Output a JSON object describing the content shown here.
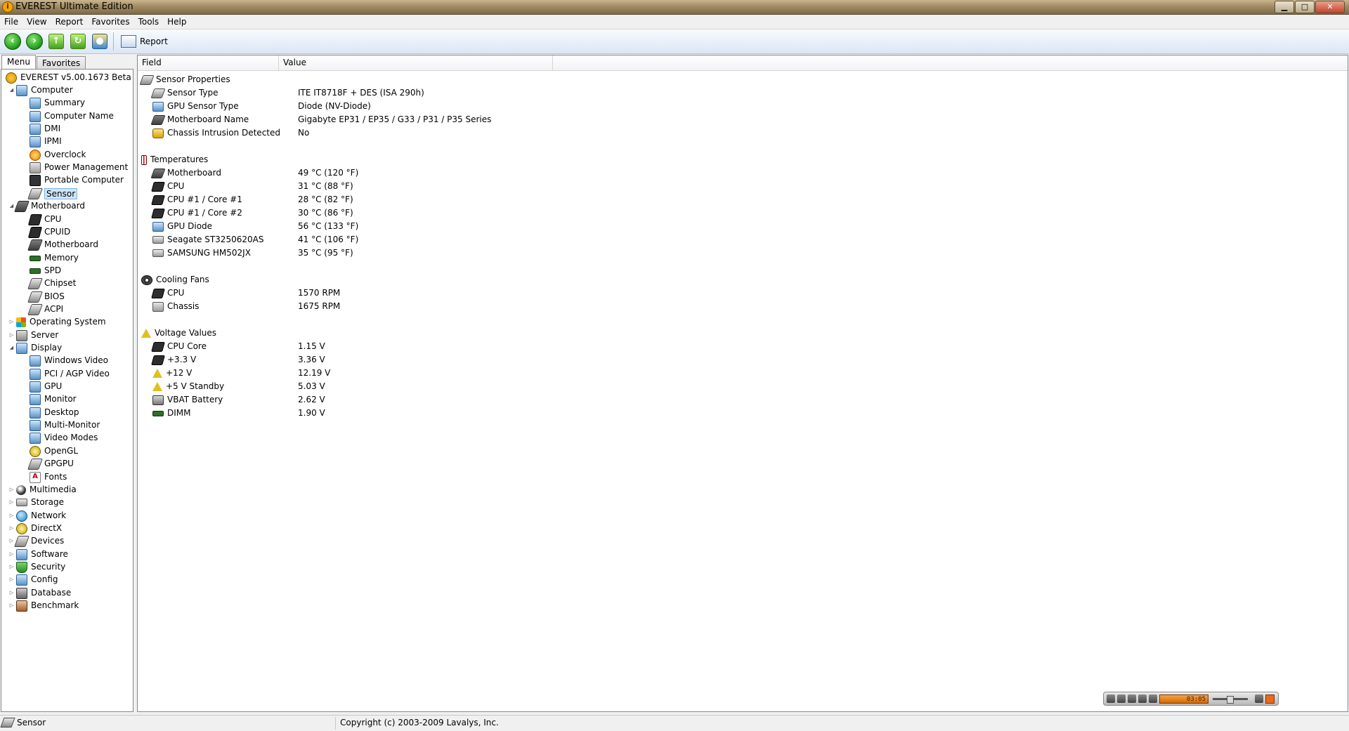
{
  "window": {
    "title": "EVEREST Ultimate Edition",
    "icon": "info-icon",
    "minimize": "▁",
    "maximize": "□",
    "close": "✕"
  },
  "menubar": [
    "File",
    "View",
    "Report",
    "Favorites",
    "Tools",
    "Help"
  ],
  "toolbar": {
    "back": "back-icon",
    "forward": "forward-icon",
    "up": "up-icon",
    "refresh": "refresh-icon",
    "users": "users-icon",
    "report_label": "Report"
  },
  "tabs": [
    "Menu",
    "Favorites"
  ],
  "tree": {
    "root": "EVEREST v5.00.1673 Beta",
    "items": [
      {
        "label": "Computer"
      },
      {
        "label": "Summary"
      },
      {
        "label": "Computer Name"
      },
      {
        "label": "DMI"
      },
      {
        "label": "IPMI"
      },
      {
        "label": "Overclock"
      },
      {
        "label": "Power Management"
      },
      {
        "label": "Portable Computer"
      },
      {
        "label": "Sensor"
      },
      {
        "label": "Motherboard"
      },
      {
        "label": "CPU"
      },
      {
        "label": "CPUID"
      },
      {
        "label": "Motherboard"
      },
      {
        "label": "Memory"
      },
      {
        "label": "SPD"
      },
      {
        "label": "Chipset"
      },
      {
        "label": "BIOS"
      },
      {
        "label": "ACPI"
      },
      {
        "label": "Operating System"
      },
      {
        "label": "Server"
      },
      {
        "label": "Display"
      },
      {
        "label": "Windows Video"
      },
      {
        "label": "PCI / AGP Video"
      },
      {
        "label": "GPU"
      },
      {
        "label": "Monitor"
      },
      {
        "label": "Desktop"
      },
      {
        "label": "Multi-Monitor"
      },
      {
        "label": "Video Modes"
      },
      {
        "label": "OpenGL"
      },
      {
        "label": "GPGPU"
      },
      {
        "label": "Fonts"
      },
      {
        "label": "Multimedia"
      },
      {
        "label": "Storage"
      },
      {
        "label": "Network"
      },
      {
        "label": "DirectX"
      },
      {
        "label": "Devices"
      },
      {
        "label": "Software"
      },
      {
        "label": "Security"
      },
      {
        "label": "Config"
      },
      {
        "label": "Database"
      },
      {
        "label": "Benchmark"
      }
    ]
  },
  "columns": {
    "field": "Field",
    "value": "Value"
  },
  "sections": [
    {
      "title": "Sensor Properties",
      "rows": [
        {
          "field": "Sensor Type",
          "value": "ITE IT8718F + DES  (ISA 290h)"
        },
        {
          "field": "GPU Sensor Type",
          "value": "Diode  (NV-Diode)"
        },
        {
          "field": "Motherboard Name",
          "value": "Gigabyte EP31 / EP35 / G33 / P31 / P35 Series"
        },
        {
          "field": "Chassis Intrusion Detected",
          "value": "No"
        }
      ]
    },
    {
      "title": "Temperatures",
      "rows": [
        {
          "field": "Motherboard",
          "value": "49 °C  (120 °F)"
        },
        {
          "field": "CPU",
          "value": "31 °C  (88 °F)"
        },
        {
          "field": "CPU #1 / Core #1",
          "value": "28 °C  (82 °F)"
        },
        {
          "field": "CPU #1 / Core #2",
          "value": "30 °C  (86 °F)"
        },
        {
          "field": "GPU Diode",
          "value": "56 °C  (133 °F)"
        },
        {
          "field": "Seagate ST3250620AS",
          "value": "41 °C  (106 °F)"
        },
        {
          "field": "SAMSUNG HM502JX",
          "value": "35 °C  (95 °F)"
        }
      ]
    },
    {
      "title": "Cooling Fans",
      "rows": [
        {
          "field": "CPU",
          "value": "1570 RPM"
        },
        {
          "field": "Chassis",
          "value": "1675 RPM"
        }
      ]
    },
    {
      "title": "Voltage Values",
      "rows": [
        {
          "field": "CPU Core",
          "value": "1.15 V"
        },
        {
          "field": "+3.3 V",
          "value": "3.36 V"
        },
        {
          "field": "+12 V",
          "value": "12.19 V"
        },
        {
          "field": "+5 V Standby",
          "value": "5.03 V"
        },
        {
          "field": "VBAT Battery",
          "value": "2.62 V"
        },
        {
          "field": "DIMM",
          "value": "1.90 V"
        }
      ]
    }
  ],
  "player": {
    "time": "03:05"
  },
  "statusbar": {
    "left": "Sensor",
    "right": "Copyright (c) 2003-2009 Lavalys, Inc."
  }
}
